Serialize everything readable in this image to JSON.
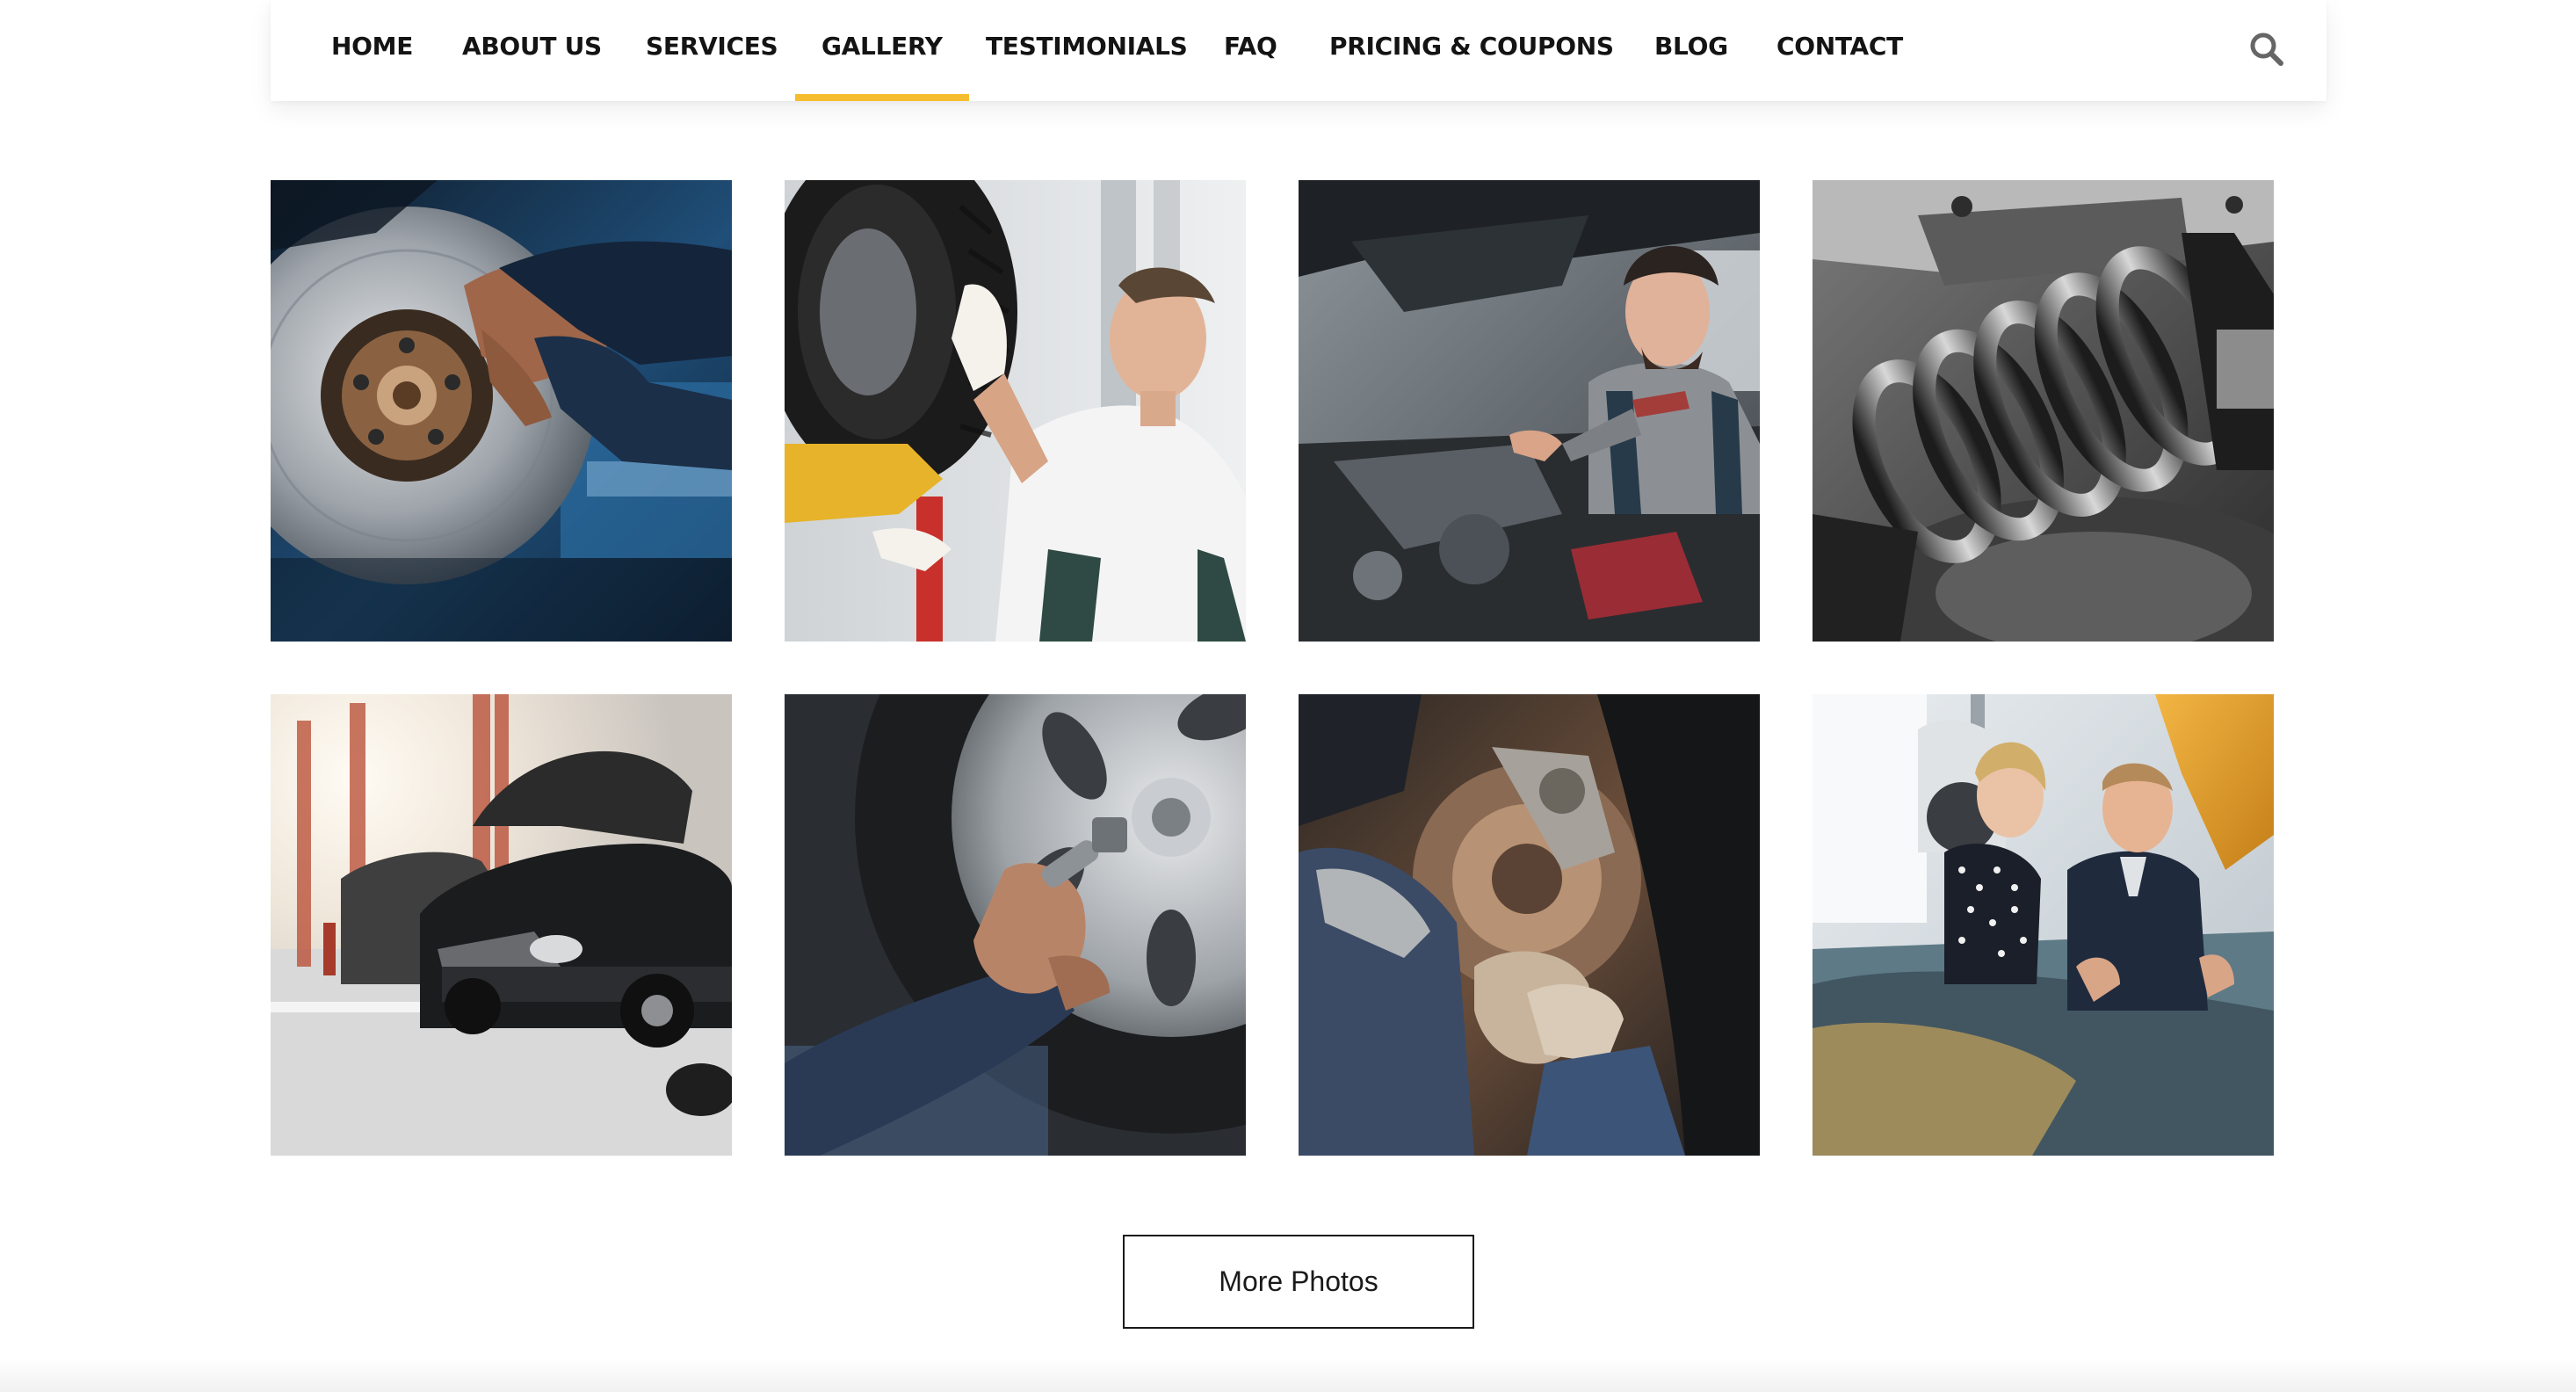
{
  "nav": {
    "items": [
      {
        "label": "HOME",
        "active": false
      },
      {
        "label": "ABOUT US",
        "active": false
      },
      {
        "label": "SERVICES",
        "active": false
      },
      {
        "label": "GALLERY",
        "active": true
      },
      {
        "label": "TESTIMONIALS",
        "active": false
      },
      {
        "label": "FAQ",
        "active": false
      },
      {
        "label": "PRICING & COUPONS",
        "active": false
      },
      {
        "label": "BLOG",
        "active": false
      },
      {
        "label": "CONTACT",
        "active": false
      }
    ],
    "search_icon": "search-icon",
    "active_underline_color": "#f6bd2e"
  },
  "gallery": {
    "photos": [
      "brake-disc-repair",
      "mechanic-mounting-tire",
      "mechanic-under-car",
      "shock-absorber-spring",
      "repair-shop-cars",
      "wheel-lug-nut-wrench",
      "brake-caliper-repair",
      "customer-and-mechanic-engine"
    ]
  },
  "more_button": {
    "label": "More Photos"
  }
}
